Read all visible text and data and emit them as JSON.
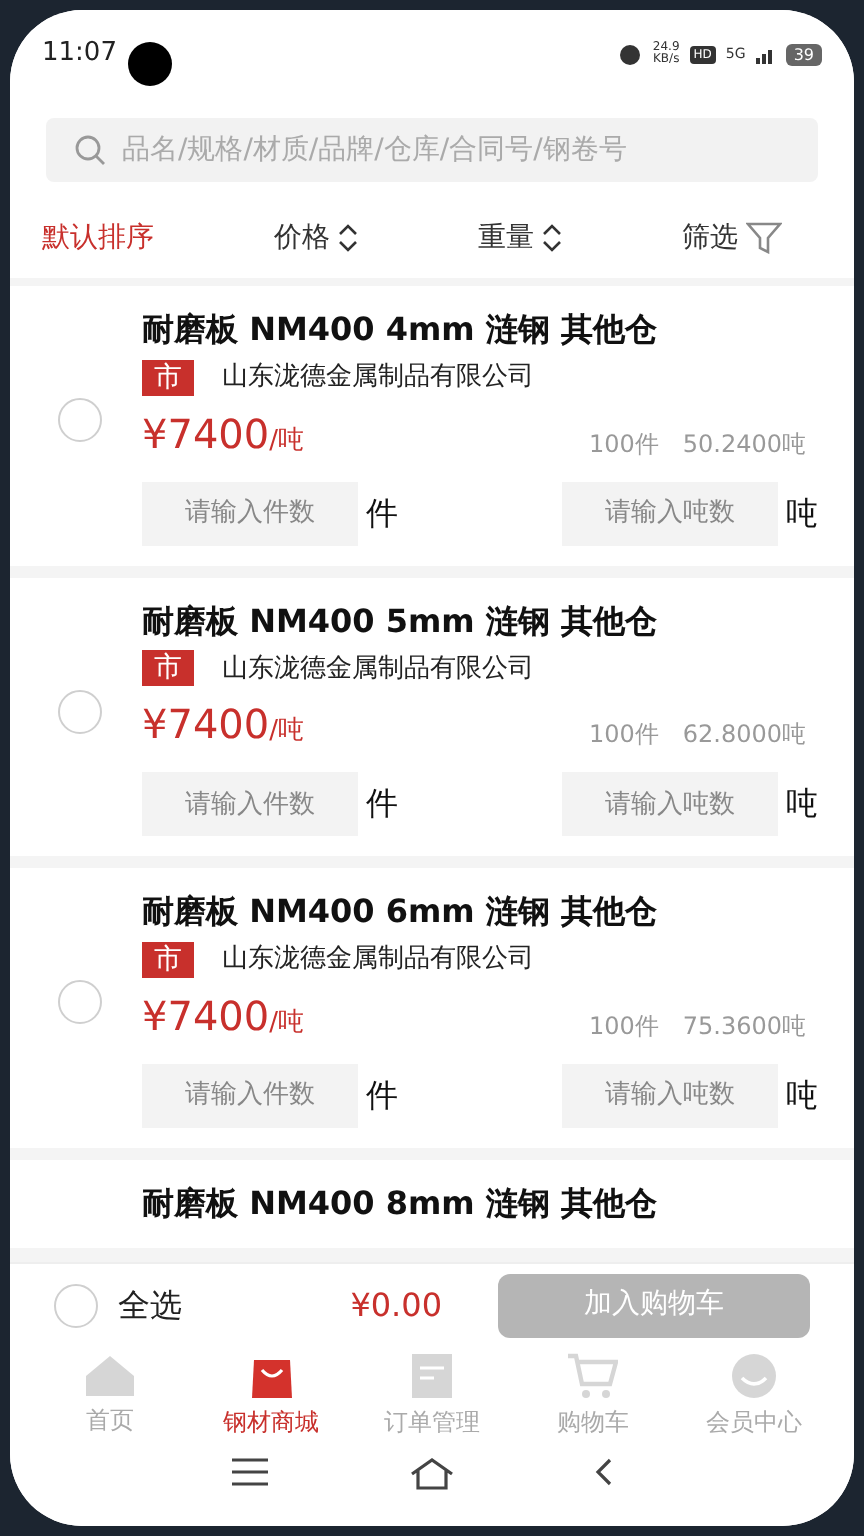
{
  "status_bar": {
    "time": "11:07",
    "net_speed": "24.9",
    "net_unit": "KB/s",
    "hd": "HD",
    "network": "5G",
    "battery": "39"
  },
  "search": {
    "placeholder": "品名/规格/材质/品牌/仓库/合同号/钢卷号"
  },
  "sort_options": [
    {
      "label": "默认排序",
      "selected": true,
      "kind": "plain"
    },
    {
      "label": "价格",
      "selected": false,
      "kind": "sortable"
    },
    {
      "label": "重量",
      "selected": false,
      "kind": "sortable"
    },
    {
      "label": "筛选",
      "selected": false,
      "kind": "filter"
    }
  ],
  "products": [
    {
      "title": "耐磨板 NM400 4mm 涟钢 其他仓",
      "tag": "市",
      "company": "山东泷德金属制品有限公司",
      "checked": false,
      "price": "¥7400",
      "price_unit": "/吨",
      "pieces": "100件",
      "weight": "50.2400吨",
      "piece_input": {
        "placeholder": "请输入件数"
      },
      "piece_unit": "件",
      "ton_input": {
        "placeholder": "请输入吨数"
      },
      "ton_unit": "吨"
    },
    {
      "title": "耐磨板 NM400 5mm 涟钢 其他仓",
      "tag": "市",
      "company": "山东泷德金属制品有限公司",
      "checked": false,
      "price": "¥7400",
      "price_unit": "/吨",
      "pieces": "100件",
      "weight": "62.8000吨",
      "piece_input": {
        "placeholder": "请输入件数"
      },
      "piece_unit": "件",
      "ton_input": {
        "placeholder": "请输入吨数"
      },
      "ton_unit": "吨"
    },
    {
      "title": "耐磨板 NM400 6mm 涟钢 其他仓",
      "tag": "市",
      "company": "山东泷德金属制品有限公司",
      "checked": false,
      "price": "¥7400",
      "price_unit": "/吨",
      "pieces": "100件",
      "weight": "75.3600吨",
      "piece_input": {
        "placeholder": "请输入件数"
      },
      "piece_unit": "件",
      "ton_input": {
        "placeholder": "请输入吨数"
      },
      "ton_unit": "吨"
    },
    {
      "title": "耐磨板 NM400 8mm 涟钢 其他仓"
    }
  ],
  "footer": {
    "select_all": {
      "label": "全选",
      "checked": false
    },
    "total": "¥0.00",
    "cart_button": {
      "label": "加入购物车",
      "disabled": true
    }
  },
  "nav": [
    {
      "label": "首页",
      "selected": false,
      "kind": "home"
    },
    {
      "label": "钢材商城",
      "selected": true,
      "kind": "bag"
    },
    {
      "label": "订单管理",
      "selected": false,
      "kind": "doc"
    },
    {
      "label": "购物车",
      "selected": false,
      "kind": "cart"
    },
    {
      "label": "会员中心",
      "selected": false,
      "kind": "face"
    }
  ]
}
